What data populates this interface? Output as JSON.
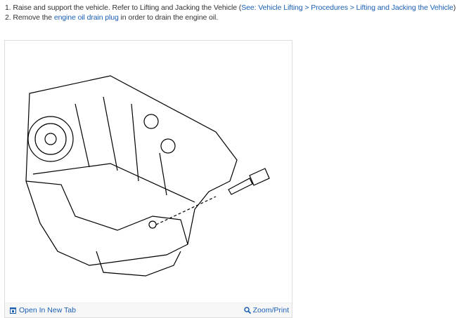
{
  "steps": [
    {
      "number": "1.",
      "text": "Raise and support the vehicle. Refer to Lifting and Jacking the Vehicle (",
      "link": "See: Vehicle Lifting > Procedures > Lifting and Jacking the Vehicle",
      "after": ") ."
    },
    {
      "number": "2.",
      "text": "Remove the ",
      "link": "engine oil drain plug",
      "after": " in order to drain the engine oil."
    }
  ],
  "figure": {
    "open_label": "Open In New Tab",
    "zoom_label": "Zoom/Print"
  },
  "colors": {
    "link": "#1a5fb4",
    "text": "#333333"
  }
}
